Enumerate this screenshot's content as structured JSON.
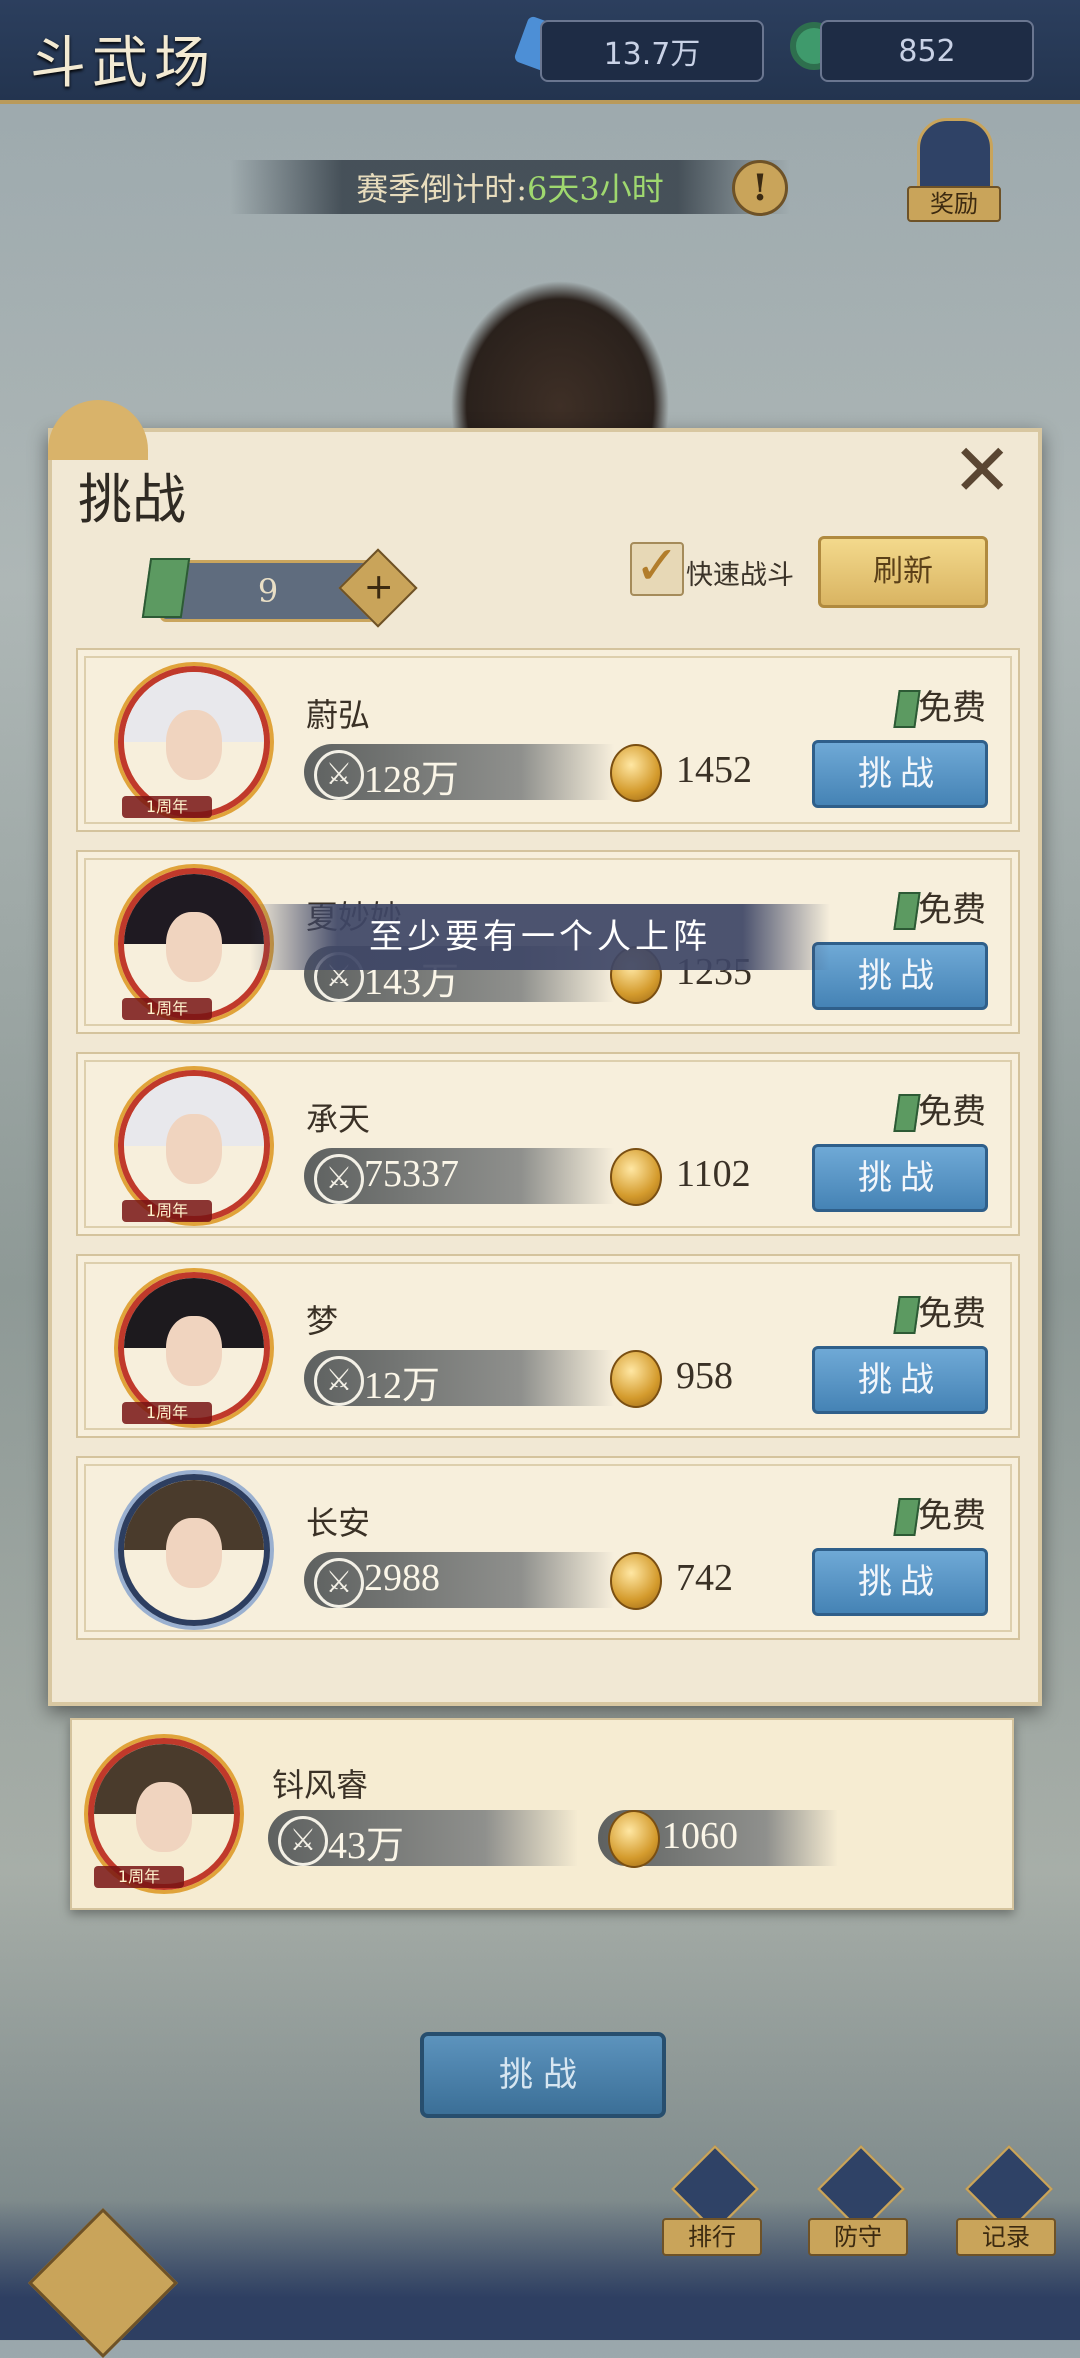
{
  "header": {
    "title": "斗武场",
    "currency_gems": "13.7万",
    "currency_jade": "852"
  },
  "season": {
    "label": "赛季倒计时:",
    "countdown": "6天3小时"
  },
  "reward_label": "奖励",
  "dialog": {
    "title": "挑战",
    "tickets": "9",
    "quick_battle_label": "快速战斗",
    "refresh_label": "刷新",
    "opponents": [
      {
        "name": "蔚弘",
        "power": "128万",
        "score": "1452",
        "cost": "免费",
        "button": "挑战",
        "badge": "1周年"
      },
      {
        "name": "夏妙妙",
        "power": "143万",
        "score": "1235",
        "cost": "免费",
        "button": "挑战",
        "badge": "1周年"
      },
      {
        "name": "承天",
        "power": "75337",
        "score": "1102",
        "cost": "免费",
        "button": "挑战",
        "badge": "1周年"
      },
      {
        "name": "梦",
        "power": "12万",
        "score": "958",
        "cost": "免费",
        "button": "挑战",
        "badge": "1周年"
      },
      {
        "name": "长安",
        "power": "2988",
        "score": "742",
        "cost": "免费",
        "button": "挑战",
        "badge": ""
      }
    ]
  },
  "toast": "至少要有一个人上阵",
  "self": {
    "name": "钭风睿",
    "power": "43万",
    "score": "1060",
    "badge": "1周年"
  },
  "bottom": {
    "challenge": "挑战",
    "ranking": "排行",
    "defense": "防守",
    "record": "记录"
  },
  "colors": {
    "accent_gold": "#c9a45a",
    "button_blue": "#4583b5",
    "panel": "#f1e8d4"
  }
}
